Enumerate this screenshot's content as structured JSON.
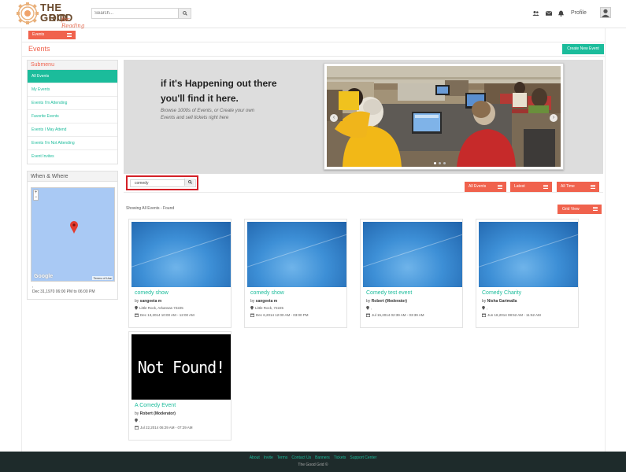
{
  "header": {
    "logo_line1": "THE GOOD",
    "logo_line2": "GRID",
    "logo_tagline": "for Reading",
    "search_placeholder": "Search...",
    "profile_label": "Profile",
    "icons": [
      "users-icon",
      "envelope-icon",
      "bell-icon",
      "avatar-icon"
    ]
  },
  "section_pill": "Events",
  "page_title": "Events",
  "create_button": "Create New Event",
  "submenu": {
    "heading": "Submenu",
    "items": [
      {
        "label": "All Events",
        "active": true
      },
      {
        "label": "My Events",
        "active": false
      },
      {
        "label": "Events I'm Attending",
        "active": false
      },
      {
        "label": "Favorite Events",
        "active": false
      },
      {
        "label": "Events I May Attend",
        "active": false
      },
      {
        "label": "Events I'm Not Attending",
        "active": false
      },
      {
        "label": "Event Invites",
        "active": false
      }
    ]
  },
  "when_where": {
    "heading": "When & Where",
    "map_zoom_in": "+",
    "map_zoom_out": "−",
    "map_brand": "Google",
    "map_terms": "Terms of Use",
    "location": ",",
    "datetime": "Dec 31,1970 06:00 PM to 06:00 PM"
  },
  "banner": {
    "headline1": "if it's Happening out there",
    "headline2": "you'll find it here.",
    "sub1": "Browse 1000s of Events, or Create your own",
    "sub2": "Events and sell tickets right here"
  },
  "search_field": {
    "value": "comedy"
  },
  "filters": {
    "all_events": "All Events",
    "latest": "Latest",
    "all_time": "All Time"
  },
  "results_label": "Showing All Events - Found",
  "grid_view_label": "Grid View",
  "events": [
    {
      "title": "comedy show",
      "by_prefix": "by",
      "author": "sangeeta m",
      "location": "Little Rock, Arkansas 72225",
      "datetime": "Dec 13,2014 10:00 AM - 12:00 AM",
      "thumb": "blue"
    },
    {
      "title": "comedy show",
      "by_prefix": "by",
      "author": "sangeeta m",
      "location": "Little Rock,  72225",
      "datetime": "Dec 6,2014 12:00 AM - 03:00 PM",
      "thumb": "blue"
    },
    {
      "title": "Comedy test event",
      "by_prefix": "by",
      "author": "Robert (Moderator)",
      "location": ",",
      "datetime": "Jul 15,2014 02:39 AM - 03:39 AM",
      "thumb": "blue"
    },
    {
      "title": "Comedy Charity",
      "by_prefix": "by",
      "author": "Nisha Garimalla",
      "location": ",",
      "datetime": "Jun 18,2014 08:52 AM - 11:52 AM",
      "thumb": "blue"
    },
    {
      "title": "A Comedy Event",
      "by_prefix": "by",
      "author": "Robert (Moderator)",
      "location": ",",
      "datetime": "Jul 22,2014 06:29 AM - 07:29 AM",
      "thumb": "notfound",
      "thumb_text": "Not Found!"
    }
  ],
  "footer": {
    "links": [
      "About",
      "Invite",
      "Terms",
      "Contact Us",
      "Banners",
      "Tickets",
      "Support Center"
    ],
    "copyright": "The Good Grid ©"
  },
  "colors": {
    "accent_orange": "#f0624d",
    "accent_teal": "#1bbc9b",
    "footer_bg": "#1e2b2b",
    "highlight_red": "#d42027"
  }
}
